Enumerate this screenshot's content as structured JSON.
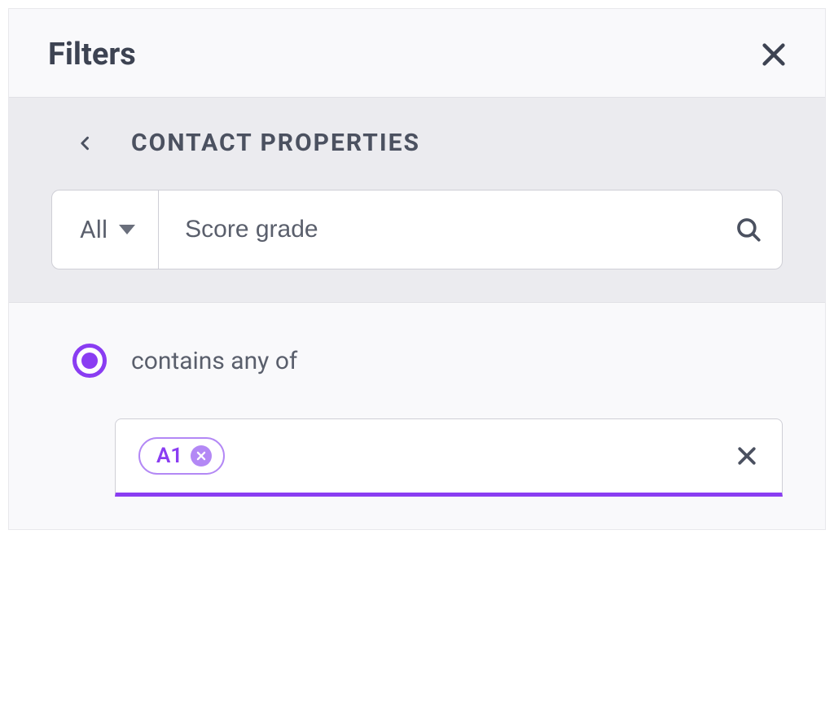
{
  "header": {
    "title": "Filters"
  },
  "section": {
    "title": "CONTACT PROPERTIES"
  },
  "search": {
    "dropdown_label": "All",
    "value": "Score grade",
    "placeholder": ""
  },
  "condition": {
    "radio_label": "contains any of",
    "tags": [
      {
        "label": "A1"
      }
    ]
  },
  "colors": {
    "accent": "#8a3df2"
  }
}
